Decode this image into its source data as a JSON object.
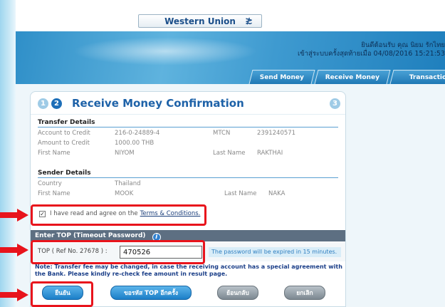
{
  "header": {
    "service": "Western Union",
    "welcome_line1": "ยินดีต้อนรับ คุณ นิยม รักไทย",
    "welcome_line2": "เข้าสู่ระบบครั้งสุดท้ายเมื่อ 04/08/2016 15:21:53",
    "tabs": [
      "Send Money",
      "Receive Money",
      "Transaction Status"
    ]
  },
  "panel": {
    "steps": [
      "1",
      "2",
      "3"
    ],
    "title": "Receive Money Confirmation",
    "transfer": {
      "heading": "Transfer Details",
      "account_label": "Account to Credit",
      "account_value": "216-0-24889-4",
      "mtcn_label": "MTCN",
      "mtcn_value": "2391240571",
      "amount_label": "Amount to Credit",
      "amount_value": "1000.00 THB",
      "first_label": "First Name",
      "first_value": "NIYOM",
      "last_label": "Last Name",
      "last_value": "RAKTHAI"
    },
    "sender": {
      "heading": "Sender Details",
      "country_label": "Country",
      "country_value": "Thailand",
      "first_label": "First Name",
      "first_value": "MOOK",
      "last_label": "Last Name",
      "last_value": "NAKA"
    },
    "agree_text": "I have read and agree on the",
    "agree_link": "Terms & Conditions.",
    "top": {
      "heading": "Enter TOP (Timeout Password)",
      "info": "i",
      "label": "TOP ( Ref No. 27678 ) :",
      "value": "470526",
      "expire": "The password will be expired in 15 minutes."
    },
    "note": "Note: Transfer fee may be changed, in case the receiving account has a special agreement with the Bank. Please kindly re-check fee amount in result page.",
    "buttons": {
      "confirm": "ยืนยัน",
      "request_top": "ขอรหัส TOP อีกครั้ง",
      "back": "ย้อนกลับ",
      "cancel": "ยกเลิก"
    }
  },
  "colors": {
    "annotation_red": "#e8141c",
    "brand_blue": "#1e62a8"
  }
}
